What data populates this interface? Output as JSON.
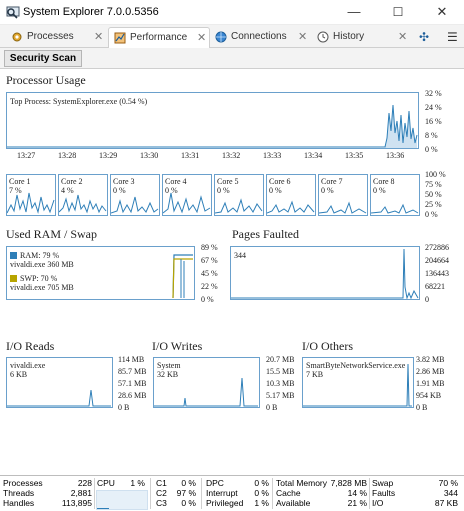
{
  "window": {
    "title": "System Explorer 7.0.0.5356",
    "buttons": {
      "minimize": "—",
      "maximize": "☐",
      "close": "✕"
    }
  },
  "tabs": [
    {
      "label": "Processes",
      "icon": "gear-icon",
      "close": "✕",
      "active": false
    },
    {
      "label": "Performance",
      "icon": "performance-icon",
      "close": "✕",
      "active": true
    },
    {
      "label": "Connections",
      "icon": "globe-icon",
      "close": "✕",
      "active": false
    },
    {
      "label": "History",
      "icon": "clock-icon",
      "close": "✕",
      "active": false
    }
  ],
  "tabbar_actions": {
    "add": "✣",
    "menu": "☰"
  },
  "toolbar": {
    "scan_label": "Security Scan"
  },
  "processor": {
    "title": "Processor Usage",
    "top_process": "Top Process: SystemExplorer.exe (0.54 %)",
    "y_ticks": [
      "32 %",
      "24 %",
      "16 %",
      "8 %",
      "0 %"
    ],
    "x_ticks": [
      "13:27",
      "13:28",
      "13:29",
      "13:30",
      "13:31",
      "13:32",
      "13:33",
      "13:34",
      "13:35",
      "13:36"
    ],
    "cores": [
      {
        "name": "Core 1",
        "value": "7 %"
      },
      {
        "name": "Core 2",
        "value": "4 %"
      },
      {
        "name": "Core 3",
        "value": "0 %"
      },
      {
        "name": "Core 4",
        "value": "0 %"
      },
      {
        "name": "Core 5",
        "value": "0 %"
      },
      {
        "name": "Core 6",
        "value": "0 %"
      },
      {
        "name": "Core 7",
        "value": "0 %"
      },
      {
        "name": "Core 8",
        "value": "0 %"
      }
    ],
    "core_y_ticks": [
      "100 %",
      "75 %",
      "50 %",
      "25 %",
      "0 %"
    ]
  },
  "ram": {
    "title": "Used RAM / Swap",
    "ram_label": "RAM: 79 %",
    "ram_top": "vivaldi.exe 360 MB",
    "swp_label": "SWP: 70 %",
    "swp_top": "vivaldi.exe 705 MB",
    "y_ticks": [
      "89 %",
      "67 %",
      "45 %",
      "22 %",
      "0 %"
    ],
    "ram_color": "#2e7fb8",
    "swp_color": "#b7a400"
  },
  "pages": {
    "title": "Pages Faulted",
    "value": "344",
    "y_ticks": [
      "272886",
      "204664",
      "136443",
      "68221",
      "0"
    ]
  },
  "io_reads": {
    "title": "I/O Reads",
    "top": "vivaldi.exe",
    "value": "6 KB",
    "y_ticks": [
      "114 MB",
      "85.7 MB",
      "57.1 MB",
      "28.6 MB",
      "0 B"
    ]
  },
  "io_writes": {
    "title": "I/O Writes",
    "top": "System",
    "value": "32 KB",
    "y_ticks": [
      "20.7 MB",
      "15.5 MB",
      "10.3 MB",
      "5.17 MB",
      "0 B"
    ]
  },
  "io_others": {
    "title": "I/O Others",
    "top": "SmartByteNetworkService.exe",
    "value": "7 KB",
    "y_ticks": [
      "3.82 MB",
      "2.86 MB",
      "1.91 MB",
      "954 KB",
      "0 B"
    ]
  },
  "status": {
    "processes_label": "Processes",
    "processes": "228",
    "threads_label": "Threads",
    "threads": "2,881",
    "handles_label": "Handles",
    "handles": "113,895",
    "cpu_label": "CPU",
    "cpu": "1 %",
    "c1_label": "C1",
    "c1": "0 %",
    "c2_label": "C2",
    "c2": "97 %",
    "c3_label": "C3",
    "c3": "0 %",
    "dpc_label": "DPC",
    "dpc": "0 %",
    "interrupt_label": "Interrupt",
    "interrupt": "0 %",
    "privileged_label": "Privileged",
    "privileged": "1 %",
    "total_memory_label": "Total Memory",
    "total_memory": "7,828 MB",
    "cache_label": "Cache",
    "cache": "14 %",
    "available_label": "Available",
    "available": "21 %",
    "swap_label": "Swap",
    "swap": "70 %",
    "faults_label": "Faults",
    "faults": "344",
    "io_label": "I/O",
    "io": "87 KB"
  },
  "colors": {
    "graph_line": "#2e7fb8",
    "graph_fill": "#cfe2f1",
    "graph_border": "#6aa0cc"
  }
}
